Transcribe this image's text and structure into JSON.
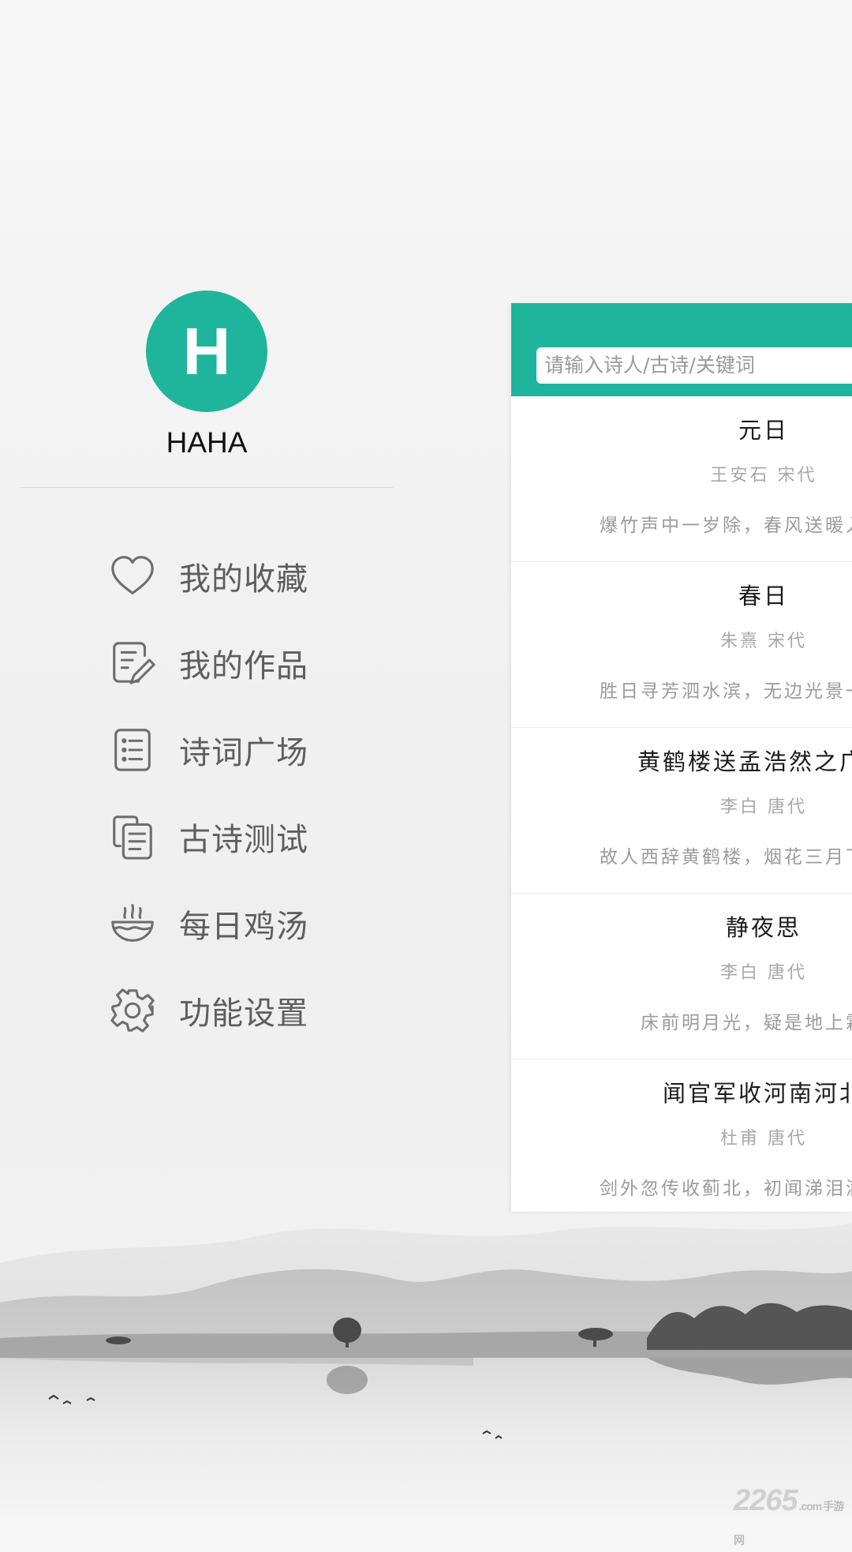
{
  "colors": {
    "accent": "#1fb59d",
    "menu_text": "#5e5e5e"
  },
  "profile": {
    "avatar_letter": "H",
    "name": "HAHA"
  },
  "menu": [
    {
      "label": "我的收藏",
      "icon": "heart-icon"
    },
    {
      "label": "我的作品",
      "icon": "edit-note-icon"
    },
    {
      "label": "诗词广场",
      "icon": "list-icon"
    },
    {
      "label": "古诗测试",
      "icon": "copy-document-icon"
    },
    {
      "label": "每日鸡汤",
      "icon": "soup-bowl-icon"
    },
    {
      "label": "功能设置",
      "icon": "gear-icon"
    }
  ],
  "search": {
    "placeholder": "请输入诗人/古诗/关键词"
  },
  "poems": [
    {
      "title": "元日",
      "author": "王安石  宋代",
      "line": "爆竹声中一岁除，春风送暖入屠苏。"
    },
    {
      "title": "春日",
      "author": "朱熹  宋代",
      "line": "胜日寻芳泗水滨，无边光景一时新。"
    },
    {
      "title": "黄鹤楼送孟浩然之广陵",
      "author": "李白  唐代",
      "line": "故人西辞黄鹤楼，烟花三月下扬州。"
    },
    {
      "title": "静夜思",
      "author": "李白  唐代",
      "line": "床前明月光，疑是地上霜。"
    },
    {
      "title": "闻官军收河南河北",
      "author": "杜甫  唐代",
      "line": "剑外忽传收蓟北，初闻涕泪满衣裳。"
    }
  ],
  "watermark": {
    "brand": "2265",
    "suffix": ".com",
    "tag": "手游网"
  }
}
